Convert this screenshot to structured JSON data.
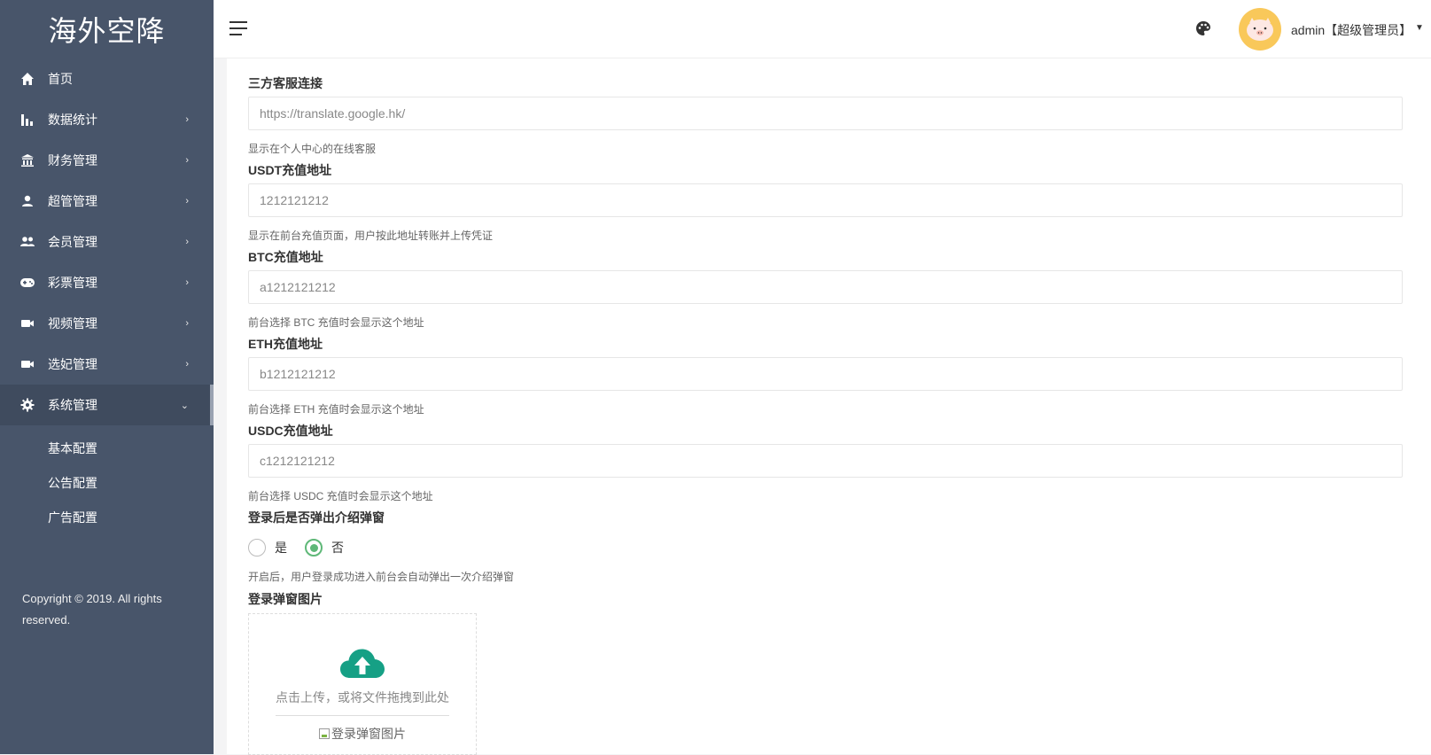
{
  "app": {
    "logo_text": "海外空降"
  },
  "sidebar": {
    "items": [
      {
        "label": "首页",
        "icon": "home-icon",
        "has_arrow": false
      },
      {
        "label": "数据统计",
        "icon": "bar-chart-icon",
        "has_arrow": true
      },
      {
        "label": "财务管理",
        "icon": "bank-icon",
        "has_arrow": true
      },
      {
        "label": "超管管理",
        "icon": "user-icon",
        "has_arrow": true
      },
      {
        "label": "会员管理",
        "icon": "users-icon",
        "has_arrow": true
      },
      {
        "label": "彩票管理",
        "icon": "gamepad-icon",
        "has_arrow": true
      },
      {
        "label": "视频管理",
        "icon": "video-icon",
        "has_arrow": true
      },
      {
        "label": "选妃管理",
        "icon": "video-icon",
        "has_arrow": true
      },
      {
        "label": "系统管理",
        "icon": "gear-icon",
        "has_arrow": true,
        "expanded": true
      }
    ],
    "submenu": [
      {
        "label": "基本配置"
      },
      {
        "label": "公告配置"
      },
      {
        "label": "广告配置"
      }
    ],
    "copyright": "Copyright © 2019. All rights reserved."
  },
  "header": {
    "user_label": "admin【超级管理员】"
  },
  "form": {
    "fields": [
      {
        "label": "三方客服连接",
        "value": "https://translate.google.hk/",
        "help": "显示在个人中心的在线客服"
      },
      {
        "label": "USDT充值地址",
        "value": "1212121212",
        "help": "显示在前台充值页面，用户按此地址转账并上传凭证"
      },
      {
        "label": "BTC充值地址",
        "value": "a1212121212",
        "help": "前台选择 BTC 充值时会显示这个地址"
      },
      {
        "label": "ETH充值地址",
        "value": "b1212121212",
        "help": "前台选择 ETH 充值时会显示这个地址"
      },
      {
        "label": "USDC充值地址",
        "value": "c1212121212",
        "help": "前台选择 USDC 充值时会显示这个地址"
      }
    ],
    "popup": {
      "label": "登录后是否弹出介绍弹窗",
      "options": [
        {
          "label": "是",
          "checked": false
        },
        {
          "label": "否",
          "checked": true
        }
      ],
      "help": "开启后，用户登录成功进入前台会自动弹出一次介绍弹窗"
    },
    "popup_image": {
      "label": "登录弹窗图片",
      "upload_text": "点击上传，或将文件拖拽到此处",
      "image_alt": "登录弹窗图片"
    }
  },
  "colors": {
    "sidebar_bg": "#48556a",
    "accent": "#5fb878",
    "upload_icon": "#16a085",
    "avatar_bg": "#f9c85a"
  }
}
